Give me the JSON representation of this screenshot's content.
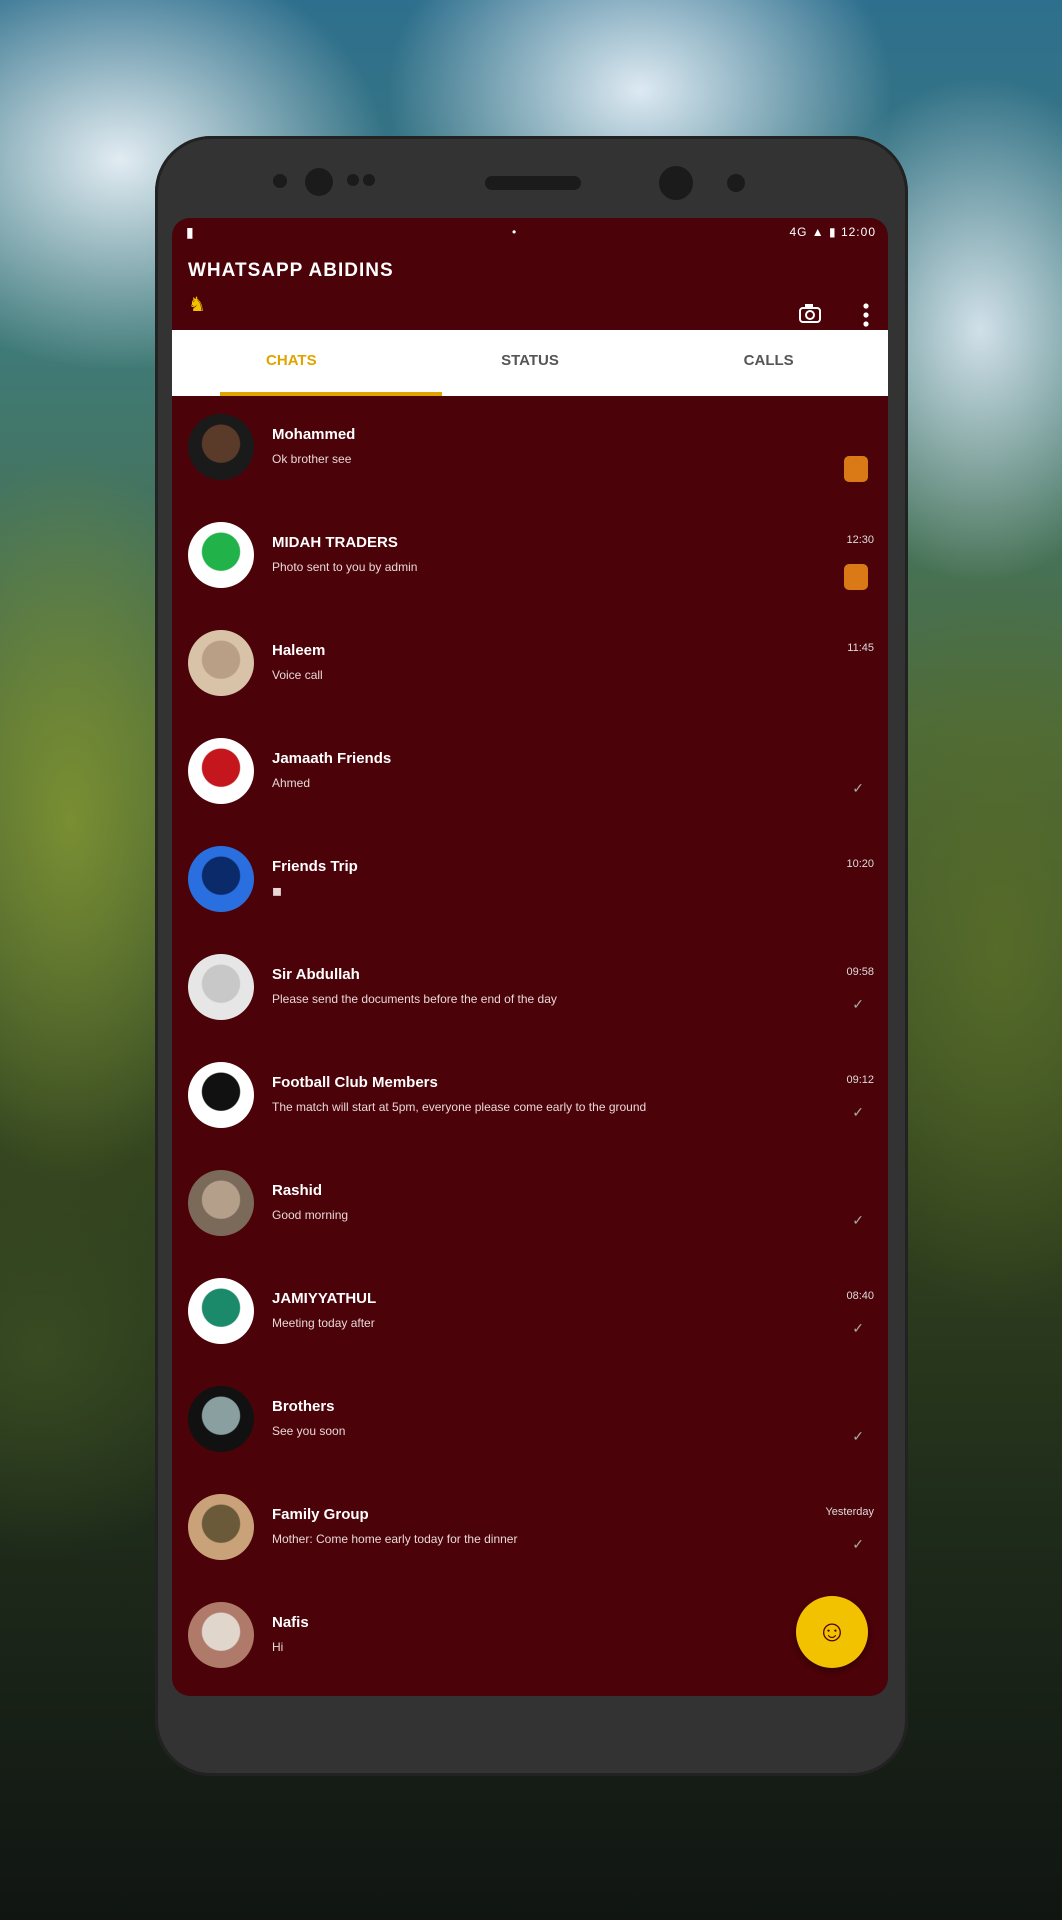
{
  "app": {
    "title": "WHATSAPP ABIDINS",
    "sub_icon": "♞"
  },
  "header": {
    "camera_icon": "camera-icon",
    "menu_icon": "more-vertical-icon"
  },
  "status_bar": {
    "left": "▮",
    "center": "•",
    "right": "4G ▲ ▮ 12:00"
  },
  "tabs": [
    {
      "label": "CHATS"
    },
    {
      "label": "STATUS"
    },
    {
      "label": "CALLS"
    }
  ],
  "chats": [
    {
      "name": "Mohammed",
      "preview": "Ok brother see",
      "time": "",
      "avatar_colors": [
        "#1a1a1a",
        "#5a3b2a"
      ],
      "indicator": "badge"
    },
    {
      "name": "MIDAH TRADERS",
      "preview": "Photo sent to you by admin",
      "time": "12:30",
      "avatar_colors": [
        "#ffffff",
        "#21b24a"
      ],
      "indicator": "badge"
    },
    {
      "name": "Haleem",
      "preview": "Voice call",
      "time": "11:45",
      "avatar_colors": [
        "#d8c2a8",
        "#b89f86"
      ],
      "indicator": "none"
    },
    {
      "name": "Jamaath Friends",
      "preview": "Ahmed",
      "time": "",
      "avatar_colors": [
        "#ffffff",
        "#c4161c"
      ],
      "indicator": "tick"
    },
    {
      "name": "Friends Trip",
      "preview": "◼",
      "time": "10:20",
      "avatar_colors": [
        "#2a6fe0",
        "#0b2a6a"
      ],
      "indicator": "none"
    },
    {
      "name": "Sir Abdullah",
      "preview": "Please send the documents before the end of the day",
      "time": "09:58",
      "avatar_colors": [
        "#e6e6e6",
        "#c8c8c8"
      ],
      "indicator": "tick"
    },
    {
      "name": "Football Club Members",
      "preview": "The match will start at 5pm, everyone please come early to the ground",
      "time": "09:12",
      "avatar_colors": [
        "#ffffff",
        "#111111"
      ],
      "indicator": "tick"
    },
    {
      "name": "Rashid",
      "preview": "Good morning",
      "time": "",
      "avatar_colors": [
        "#7b6a5a",
        "#b4a08a"
      ],
      "indicator": "tick"
    },
    {
      "name": "JAMIYYATHUL",
      "preview": "Meeting today after",
      "time": "08:40",
      "avatar_colors": [
        "#ffffff",
        "#1a8a6a"
      ],
      "indicator": "tick"
    },
    {
      "name": "Brothers",
      "preview": "See you soon",
      "time": "",
      "avatar_colors": [
        "#111111",
        "#8aa0a0"
      ],
      "indicator": "tick"
    },
    {
      "name": "Family Group",
      "preview": "Mother: Come home early today for the dinner",
      "time": "Yesterday",
      "avatar_colors": [
        "#c9a27a",
        "#6a5a3a"
      ],
      "indicator": "tick"
    },
    {
      "name": "Nafis",
      "preview": "Hi",
      "time": "",
      "avatar_colors": [
        "#b07a6a",
        "#e0d6cc"
      ],
      "indicator": "none"
    }
  ],
  "fab": {
    "icon": "☺"
  }
}
